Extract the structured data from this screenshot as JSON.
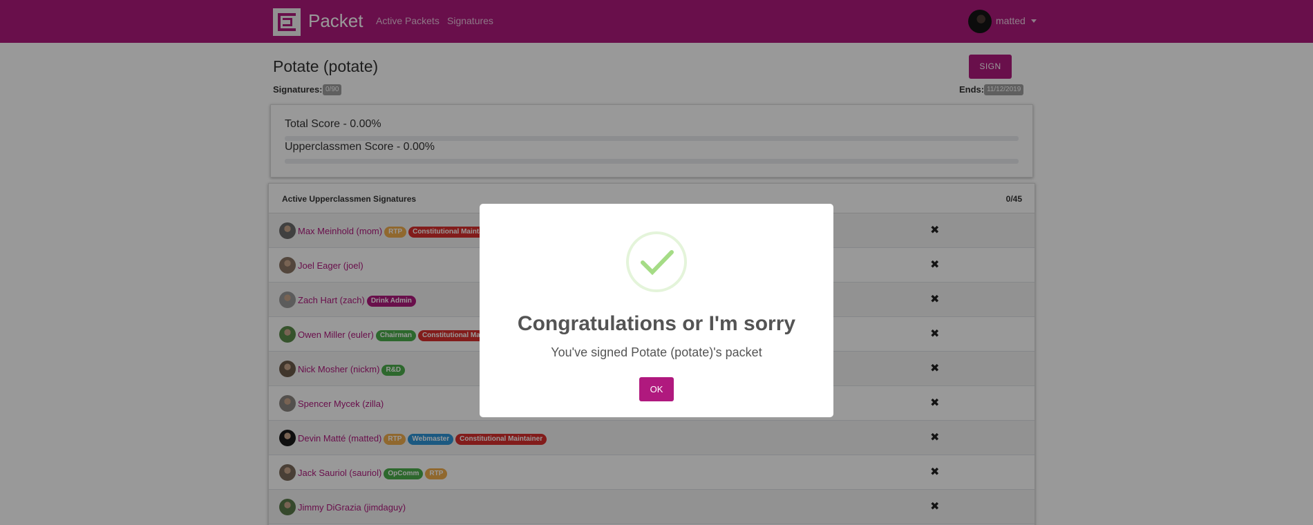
{
  "navbar": {
    "brand": "Packet",
    "links": [
      "Active Packets",
      "Signatures"
    ],
    "user": "matted"
  },
  "packet": {
    "title": "Potate (potate)",
    "sign_label": "SIGN",
    "signatures_label": "Signatures:",
    "signatures_value": "0/90",
    "ends_label": "Ends:",
    "ends_value": "11/12/2019"
  },
  "scores": {
    "total_label": "Total Score - 0.00%",
    "total_fraction": 0.0,
    "upper_label": "Upperclassmen Score - 0.00%",
    "upper_fraction": 0.0
  },
  "signatures": {
    "title": "Active Upperclassmen Signatures",
    "count": "0/45",
    "rows": [
      {
        "name": "Max Meinhold (mom)",
        "tags": [
          {
            "text": "RTP",
            "kind": "rtp"
          },
          {
            "text": "Constitutional Maintainer",
            "kind": "red"
          }
        ]
      },
      {
        "name": "Joel Eager (joel)",
        "tags": []
      },
      {
        "name": "Zach Hart (zach)",
        "tags": [
          {
            "text": "Drink Admin",
            "kind": "purple"
          }
        ]
      },
      {
        "name": "Owen Miller (euler)",
        "tags": [
          {
            "text": "Chairman",
            "kind": "green"
          },
          {
            "text": "Constitutional Maintainer",
            "kind": "red"
          }
        ]
      },
      {
        "name": "Nick Mosher (nickm)",
        "tags": [
          {
            "text": "R&D",
            "kind": "green"
          }
        ]
      },
      {
        "name": "Spencer Mycek (zilla)",
        "tags": []
      },
      {
        "name": "Devin Matté (matted)",
        "tags": [
          {
            "text": "RTP",
            "kind": "rtp"
          },
          {
            "text": "Webmaster",
            "kind": "blue"
          },
          {
            "text": "Constitutional Maintainer",
            "kind": "red"
          }
        ]
      },
      {
        "name": "Jack Sauriol (sauriol)",
        "tags": [
          {
            "text": "OpComm",
            "kind": "green"
          },
          {
            "text": "RTP",
            "kind": "rtp"
          }
        ]
      },
      {
        "name": "Jimmy DiGrazia (jimdaguy)",
        "tags": []
      }
    ],
    "status_icon": "close-icon",
    "status_mark": "✖"
  },
  "modal": {
    "title": "Congratulations or I'm sorry",
    "text": "You've signed Potate (potate)'s packet",
    "ok_label": "OK",
    "icon": "success-check-icon"
  },
  "colors": {
    "brand": "#b0197e",
    "success": "#a5dc86"
  }
}
